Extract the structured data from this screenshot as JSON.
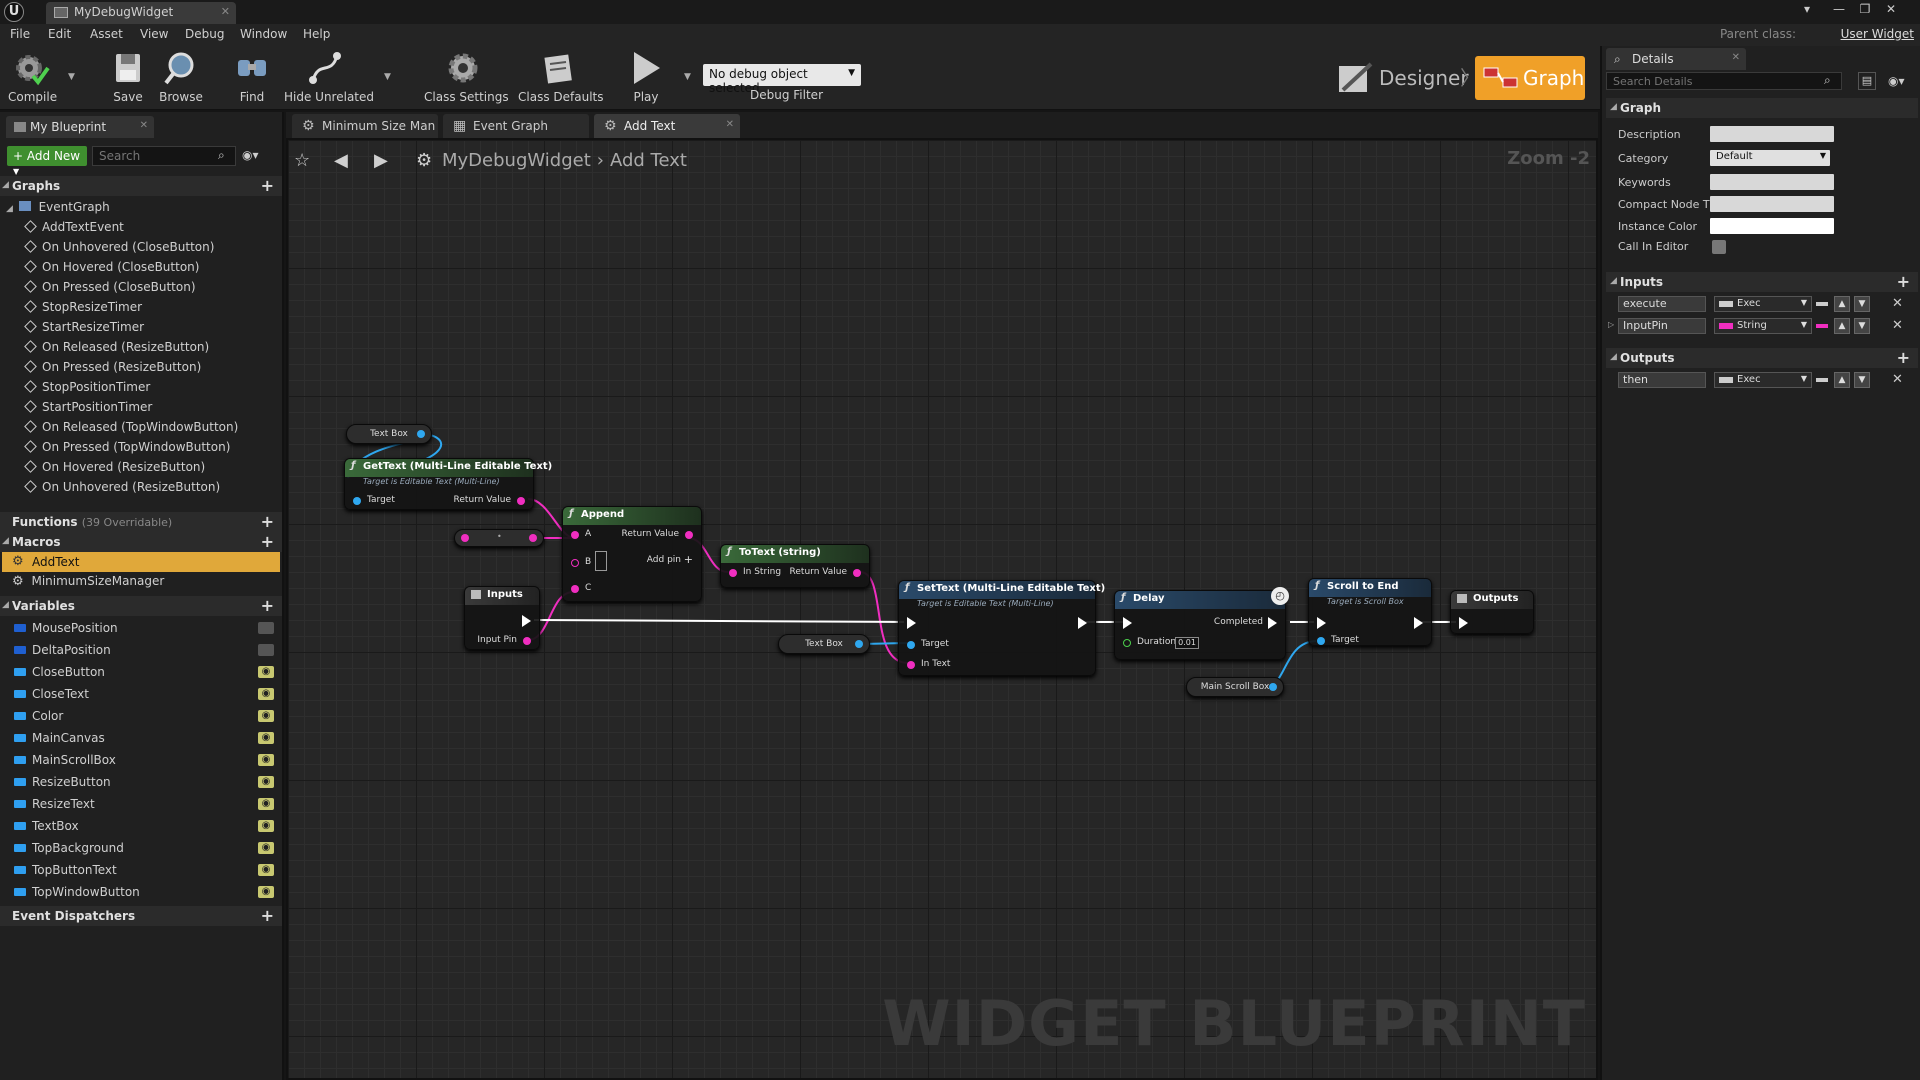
{
  "window": {
    "tab_title": "MyDebugWidget",
    "logo_text": "U",
    "controls": [
      "▾",
      "—",
      "❐",
      "✕"
    ]
  },
  "menu": {
    "items": [
      "File",
      "Edit",
      "Asset",
      "View",
      "Debug",
      "Window",
      "Help"
    ],
    "parent_class_label": "Parent class:",
    "parent_class_value": "User Widget"
  },
  "toolbar": {
    "buttons": [
      "Compile",
      "Save",
      "Browse",
      "Find",
      "Hide Unrelated",
      "Class Settings",
      "Class Defaults",
      "Play"
    ],
    "debug_object": "No debug object selected",
    "debug_filter": "Debug Filter",
    "designer": "Designer",
    "graph": "Graph"
  },
  "my_blueprint": {
    "tab": "My Blueprint",
    "add_new": "Add New",
    "search_placeholder": "Search",
    "graphs_header": "Graphs",
    "event_graph": "EventGraph",
    "events": [
      "AddTextEvent",
      "On Unhovered (CloseButton)",
      "On Hovered (CloseButton)",
      "On Pressed (CloseButton)",
      "StopResizeTimer",
      "StartResizeTimer",
      "On Released (ResizeButton)",
      "On Pressed (ResizeButton)",
      "StopPositionTimer",
      "StartPositionTimer",
      "On Released (TopWindowButton)",
      "On Pressed (TopWindowButton)",
      "On Hovered (ResizeButton)",
      "On Unhovered (ResizeButton)"
    ],
    "functions_header": "Functions",
    "functions_sub": "(39 Overridable)",
    "macros_header": "Macros",
    "macros": [
      "AddText",
      "MinimumSizeManager"
    ],
    "variables_header": "Variables",
    "variables": [
      {
        "name": "MousePosition",
        "color": "#1f5fd0",
        "visible": false
      },
      {
        "name": "DeltaPosition",
        "color": "#1f5fd0",
        "visible": false
      },
      {
        "name": "CloseButton",
        "color": "#2f9ff0",
        "visible": true
      },
      {
        "name": "CloseText",
        "color": "#2f9ff0",
        "visible": true
      },
      {
        "name": "Color",
        "color": "#2f9ff0",
        "visible": true
      },
      {
        "name": "MainCanvas",
        "color": "#2f9ff0",
        "visible": true
      },
      {
        "name": "MainScrollBox",
        "color": "#2f9ff0",
        "visible": true
      },
      {
        "name": "ResizeButton",
        "color": "#2f9ff0",
        "visible": true
      },
      {
        "name": "ResizeText",
        "color": "#2f9ff0",
        "visible": true
      },
      {
        "name": "TextBox",
        "color": "#2f9ff0",
        "visible": true
      },
      {
        "name": "TopBackground",
        "color": "#2f9ff0",
        "visible": true
      },
      {
        "name": "TopButtonText",
        "color": "#2f9ff0",
        "visible": true
      },
      {
        "name": "TopWindowButton",
        "color": "#2f9ff0",
        "visible": true
      }
    ],
    "dispatchers_header": "Event Dispatchers"
  },
  "editor_tabs": [
    "Minimum Size Man",
    "Event Graph",
    "Add Text"
  ],
  "graph": {
    "breadcrumb_root": "MyDebugWidget",
    "breadcrumb_current": "Add Text",
    "zoom": "Zoom -2",
    "watermark": "WIDGET BLUEPRINT",
    "nodes": {
      "textbox_var": "Text Box",
      "gettext_title": "GetText (Multi-Line Editable Text)",
      "gettext_sub": "Target is Editable Text (Multi-Line)",
      "target": "Target",
      "return_value": "Return Value",
      "append_title": "Append",
      "pin_a": "A",
      "pin_b": "B",
      "pin_c": "C",
      "add_pin": "Add pin",
      "totext_title": "ToText (string)",
      "in_string": "In String",
      "inputs_title": "Inputs",
      "input_pin": "Input Pin",
      "settext_title": "SetText (Multi-Line Editable Text)",
      "settext_sub": "Target is Editable Text (Multi-Line)",
      "in_text": "In Text",
      "textbox_var2": "Text Box",
      "delay_title": "Delay",
      "completed": "Completed",
      "duration": "Duration",
      "duration_value": "0.01",
      "scroll_title": "Scroll to End",
      "scroll_sub": "Target is Scroll Box",
      "mainscroll_var": "Main Scroll Box",
      "outputs_title": "Outputs"
    }
  },
  "details": {
    "tab": "Details",
    "search_placeholder": "Search Details",
    "graph_header": "Graph",
    "fields": [
      "Description",
      "Category",
      "Keywords",
      "Compact Node Ti",
      "Instance Color",
      "Call In Editor"
    ],
    "category_value": "Default",
    "inputs_header": "Inputs",
    "inputs": [
      {
        "name": "execute",
        "type": "Exec",
        "color": "#cccccc"
      },
      {
        "name": "InputPin",
        "type": "String",
        "color": "#f02ec0"
      }
    ],
    "outputs_header": "Outputs",
    "outputs": [
      {
        "name": "then",
        "type": "Exec",
        "color": "#cccccc"
      }
    ]
  }
}
